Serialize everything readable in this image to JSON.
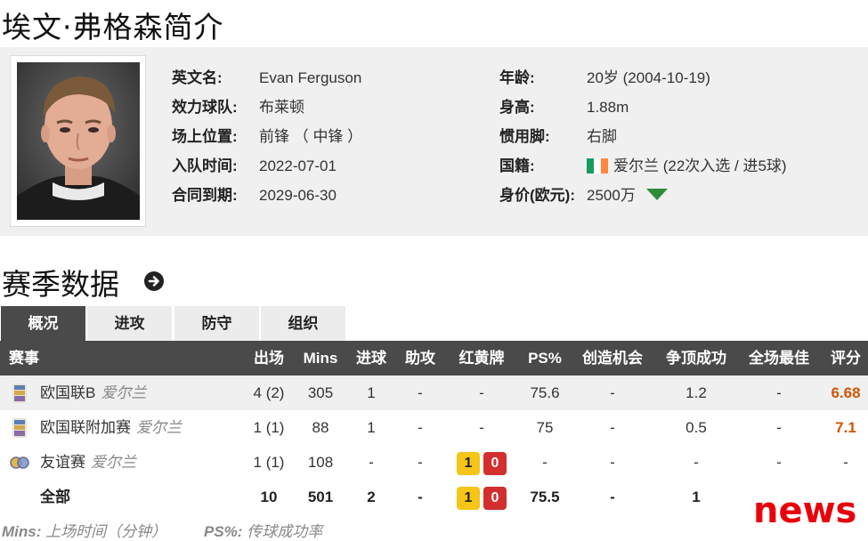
{
  "page": {
    "title": "埃文·弗格森简介"
  },
  "profile": {
    "fields_left": [
      {
        "label": "英文名:",
        "value": "Evan Ferguson"
      },
      {
        "label": "效力球队:",
        "value": "布莱顿"
      },
      {
        "label": "场上位置:",
        "value": "前锋 （ 中锋 ）"
      },
      {
        "label": "入队时间:",
        "value": "2022-07-01"
      },
      {
        "label": "合同到期:",
        "value": "2029-06-30"
      }
    ],
    "fields_right": [
      {
        "label": "年龄:",
        "value": "20岁  (2004-10-19)"
      },
      {
        "label": "身高:",
        "value": "1.88m"
      },
      {
        "label": "惯用脚:",
        "value": "右脚"
      },
      {
        "label": "国籍:",
        "value": "爱尔兰 (22次入选 / 进5球)"
      },
      {
        "label": "身价(欧元):",
        "value": "2500万"
      }
    ],
    "flag_colors": [
      "#169b62",
      "#ffffff",
      "#ff883e"
    ],
    "trend_icon": "down-arrow-icon",
    "trend_color": "#2e8b3a"
  },
  "season": {
    "title": "赛季数据",
    "tabs": [
      "概况",
      "进攻",
      "防守",
      "组织"
    ],
    "active_tab": 0,
    "headers": [
      "赛事",
      "出场",
      "Mins",
      "进球",
      "助攻",
      "红黄牌",
      "PS%",
      "创造机会",
      "争顶成功",
      "全场最佳",
      "评分"
    ],
    "rows": [
      {
        "competition": "欧国联B",
        "team": "爱尔兰",
        "icon": "nations-league-icon",
        "apps": "4 (2)",
        "mins": "305",
        "goals": "1",
        "assists": "-",
        "cards": "-",
        "yellow": "",
        "red": "",
        "ps": "75.6",
        "chances": "-",
        "aerials": "1.2",
        "motm": "-",
        "rating": "6.68"
      },
      {
        "competition": "欧国联附加赛",
        "team": "爱尔兰",
        "icon": "nations-league-icon",
        "apps": "1 (1)",
        "mins": "88",
        "goals": "1",
        "assists": "-",
        "cards": "-",
        "yellow": "",
        "red": "",
        "ps": "75",
        "chances": "-",
        "aerials": "0.5",
        "motm": "-",
        "rating": "7.1"
      },
      {
        "competition": "友谊赛",
        "team": "爱尔兰",
        "icon": "friendly-icon",
        "apps": "1 (1)",
        "mins": "108",
        "goals": "-",
        "assists": "-",
        "cards": "",
        "yellow": "1",
        "red": "0",
        "ps": "-",
        "chances": "-",
        "aerials": "-",
        "motm": "-",
        "rating": "-"
      }
    ],
    "total": {
      "label": "全部",
      "apps": "10",
      "mins": "501",
      "goals": "2",
      "assists": "-",
      "yellow": "1",
      "red": "0",
      "ps": "75.5",
      "chances": "-",
      "aerials": "1"
    },
    "footnotes": [
      {
        "key": "Mins:",
        "text": "上场时间（分钟）"
      },
      {
        "key": "PS%:",
        "text": "传球成功率"
      }
    ]
  },
  "watermark": {
    "text": "news"
  }
}
